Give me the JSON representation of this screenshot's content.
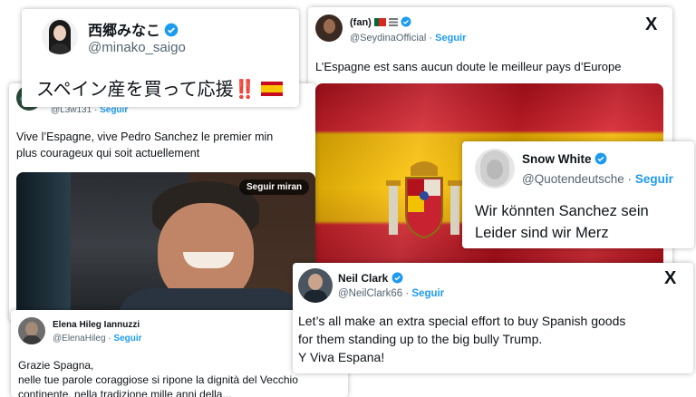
{
  "cards": {
    "minako": {
      "name": "西郷みなこ",
      "handle": "@minako_saigo",
      "text": "スペイン産を買って応援",
      "marks": "‼️",
      "flag_colors": {
        "red": "#c60b1e",
        "yellow": "#ffc400"
      }
    },
    "l3w": {
      "handle": "@L3w131",
      "follow": "Seguir",
      "text_line1": "Vive l’Espagne, vive Pedro Sanchez le premier min",
      "text_line2": "plus courageux qui soit actuellement",
      "video_overlay": "Seguir miran"
    },
    "seydina": {
      "name": "(fan)",
      "handle": "@SeydinaOfficial",
      "follow": "Seguir",
      "text": "L’Espagne est sans aucun doute le meilleur pays d’Europe",
      "x_logo": "X"
    },
    "snow": {
      "name": "Snow White",
      "handle": "@Quotendeutsche",
      "follow": "Seguir",
      "text_line1": "Wir könnten Sanchez sein",
      "text_line2": "Leider sind wir Merz"
    },
    "neil": {
      "name": "Neil Clark",
      "handle": "@NeilClark66",
      "follow": "Seguir",
      "text_line1": "Let’s all make an extra special effort to buy Spanish goods",
      "text_line2": "for them standing up to the big bully Trump.",
      "text_line3": "Y Viva Espana!",
      "x_logo": "X"
    },
    "elena": {
      "name": "Elena Hileg Iannuzzi",
      "handle": "@ElenaHileg",
      "follow": "Seguir",
      "text_line1": "Grazie Spagna,",
      "text_line2": "nelle tue parole coraggiose si ripone la dignità del Vecchio",
      "text_line3": "continente, nella tradizione mille anni della..."
    }
  },
  "separator": "·",
  "colors": {
    "link_blue": "#1d9bf0",
    "handle_gray": "#536471",
    "verified_blue": "#1d9bf0"
  }
}
